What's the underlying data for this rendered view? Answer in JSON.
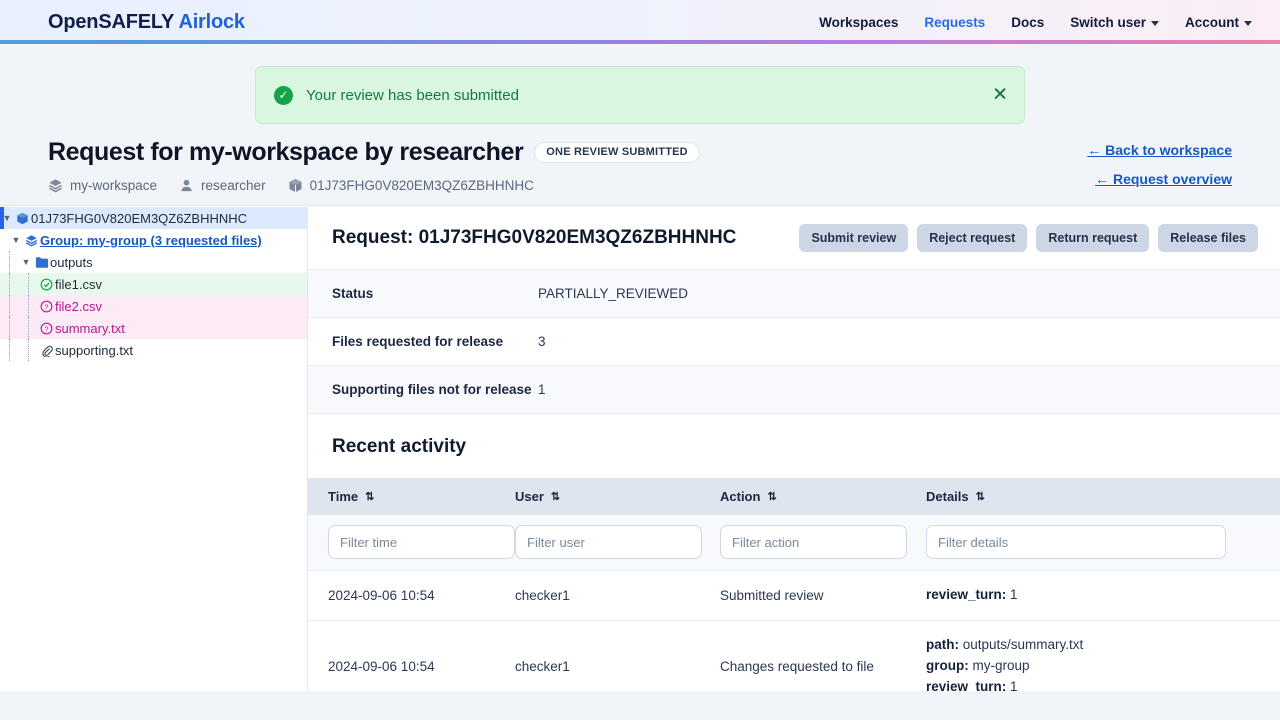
{
  "header": {
    "brand_part1": "OpenSAFELY",
    "brand_part2": "Airlock",
    "nav": [
      {
        "label": "Workspaces",
        "active": false,
        "caret": false
      },
      {
        "label": "Requests",
        "active": true,
        "caret": false
      },
      {
        "label": "Docs",
        "active": false,
        "caret": false
      },
      {
        "label": "Switch user",
        "active": false,
        "caret": true
      },
      {
        "label": "Account",
        "active": false,
        "caret": true
      }
    ]
  },
  "toast": {
    "message": "Your review has been submitted",
    "icon": "check-circle-icon",
    "close_label": "✕",
    "bg_color": "#d9f7e0",
    "text_color": "#15793c"
  },
  "page": {
    "title": "Request for my-workspace by researcher",
    "badge": "ONE REVIEW SUBMITTED",
    "meta": {
      "workspace": "my-workspace",
      "author": "researcher",
      "request_id": "01J73FHG0V820EM3QZ6ZBHHNHC"
    },
    "links": {
      "back_to_workspace": "← Back to workspace",
      "request_overview": "← Request overview"
    }
  },
  "tree": {
    "root": {
      "label": "01J73FHG0V820EM3QZ6ZBHHNHC",
      "icon": "package-icon",
      "selected": true
    },
    "group": {
      "label": "Group: my-group (3 requested files)",
      "icon": "layers-icon"
    },
    "folder": {
      "label": "outputs",
      "icon": "folder-icon"
    },
    "files": [
      {
        "label": "file1.csv",
        "icon": "check-circle-icon",
        "state": "approved"
      },
      {
        "label": "file2.csv",
        "icon": "question-circle-icon",
        "state": "changes-requested"
      },
      {
        "label": "summary.txt",
        "icon": "question-circle-icon",
        "state": "changes-requested"
      },
      {
        "label": "supporting.txt",
        "icon": "paperclip-icon",
        "state": "supporting"
      }
    ]
  },
  "panel": {
    "title": "Request: 01J73FHG0V820EM3QZ6ZBHHNHC",
    "buttons": [
      {
        "label": "Submit review"
      },
      {
        "label": "Reject request"
      },
      {
        "label": "Return request"
      },
      {
        "label": "Release files"
      }
    ],
    "details": [
      {
        "key": "Status",
        "value": "PARTIALLY_REVIEWED"
      },
      {
        "key": "Files requested for release",
        "value": "3"
      },
      {
        "key": "Supporting files not for release",
        "value": "1"
      }
    ]
  },
  "activity": {
    "title": "Recent activity",
    "columns": [
      {
        "label": "Time",
        "sort": "⇅"
      },
      {
        "label": "User",
        "sort": "⇅"
      },
      {
        "label": "Action",
        "sort": "⇅"
      },
      {
        "label": "Details",
        "sort": "⇅"
      }
    ],
    "filters": [
      {
        "placeholder": "Filter time"
      },
      {
        "placeholder": "Filter user"
      },
      {
        "placeholder": "Filter action"
      },
      {
        "placeholder": "Filter details"
      }
    ],
    "rows": [
      {
        "time": "2024-09-06 10:54",
        "user": "checker1",
        "action": "Submitted review",
        "details": [
          {
            "key": "review_turn:",
            "value": "1"
          }
        ]
      },
      {
        "time": "2024-09-06 10:54",
        "user": "checker1",
        "action": "Changes requested to file",
        "details": [
          {
            "key": "path:",
            "value": "outputs/summary.txt"
          },
          {
            "key": "group:",
            "value": "my-group"
          },
          {
            "key": "review_turn:",
            "value": "1"
          }
        ]
      }
    ]
  }
}
